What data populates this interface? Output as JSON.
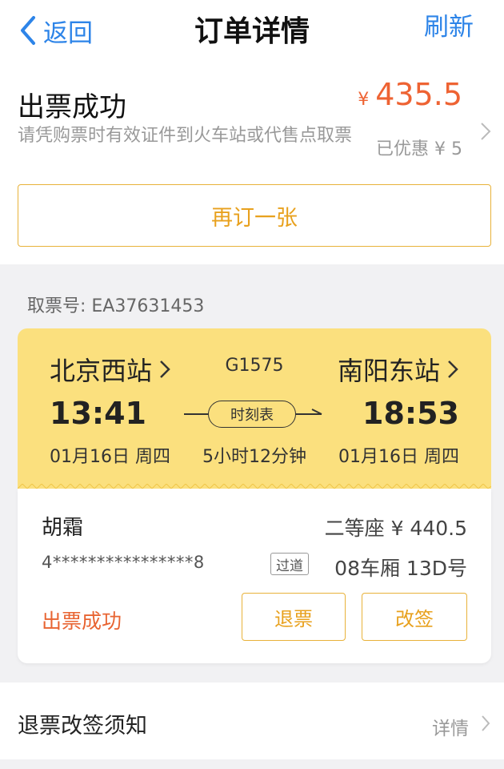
{
  "header": {
    "back_label": "返回",
    "title": "订单详情",
    "refresh_label": "刷新"
  },
  "order": {
    "status": "出票成功",
    "description": "请凭购票时有效证件到火车站或代售点取票",
    "currency": "¥",
    "price": "435.5",
    "discount": "已优惠 ¥ 5",
    "rebook_label": "再订一张"
  },
  "ticket": {
    "pickup_number": "取票号: EA37631453",
    "from_station": "北京西站",
    "to_station": "南阳东站",
    "train_number": "G1575",
    "departure_time": "13:41",
    "arrival_time": "18:53",
    "timetable_label": "时刻表",
    "departure_date": "01月16日 周四",
    "duration": "5小时12分钟",
    "arrival_date": "01月16日 周四"
  },
  "passenger": {
    "name": "胡霜",
    "seat_class_price": "二等座 ¥ 440.5",
    "id_number": "4****************8",
    "seat_tag": "过道",
    "seat_info": "08车厢 13D号",
    "status": "出票成功",
    "refund_label": "退票",
    "change_label": "改签"
  },
  "notice": {
    "title": "退票改签须知",
    "detail_label": "详情"
  },
  "colors": {
    "accent_blue": "#2d84e8",
    "price_orange": "#ee6333",
    "button_gold": "#e8a11e",
    "ticket_yellow": "#fbe07e",
    "status_red": "#e86432"
  },
  "icons": {
    "back": "chevron-left-icon",
    "arrow": "chevron-right-icon"
  }
}
